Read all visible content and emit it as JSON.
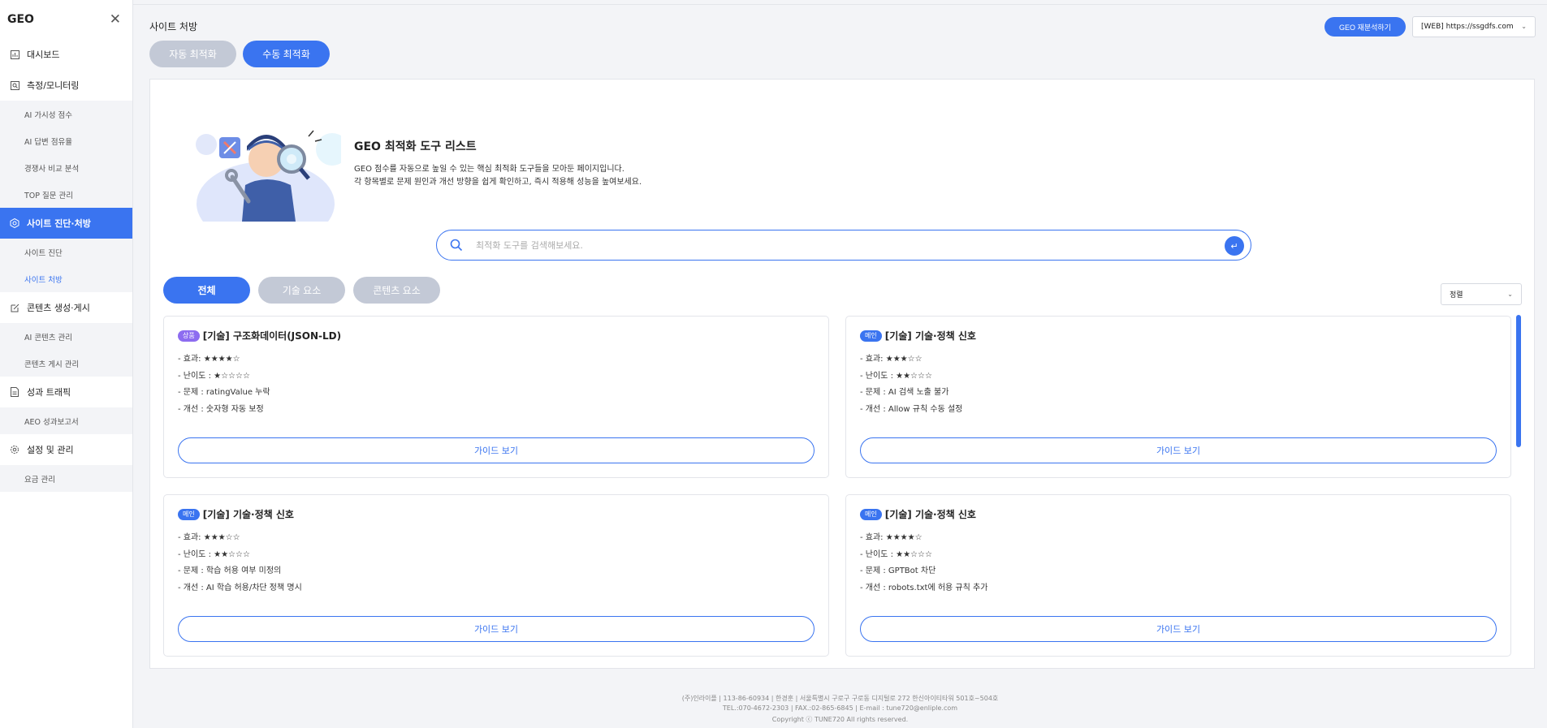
{
  "sidebar": {
    "logo": "GEO",
    "groups": [
      {
        "label": "대시보드",
        "icon": "chart-icon",
        "active": false,
        "subs": []
      },
      {
        "label": "측정/모니터링",
        "icon": "monitor-icon",
        "active": false,
        "subs": [
          {
            "label": "AI 가시성 점수",
            "active": false
          },
          {
            "label": "AI 답변 점유율",
            "active": false
          },
          {
            "label": "경쟁사 비교 분석",
            "active": false
          },
          {
            "label": "TOP 질문 관리",
            "active": false
          }
        ]
      },
      {
        "label": "사이트 진단·처방",
        "icon": "gear-hex-icon",
        "active": true,
        "subs": [
          {
            "label": "사이트 진단",
            "active": false
          },
          {
            "label": "사이트 처방",
            "active": true
          }
        ]
      },
      {
        "label": "콘텐츠 생성·게시",
        "icon": "edit-icon",
        "active": false,
        "subs": [
          {
            "label": "AI 콘텐츠 관리",
            "active": false
          },
          {
            "label": "콘텐츠 게시 관리",
            "active": false
          }
        ]
      },
      {
        "label": "성과 트래픽",
        "icon": "document-icon",
        "active": false,
        "subs": [
          {
            "label": "AEO 성과보고서",
            "active": false
          }
        ]
      },
      {
        "label": "설정 및 관리",
        "icon": "settings-icon",
        "active": false,
        "subs": [
          {
            "label": "요금 관리",
            "active": false
          }
        ]
      }
    ]
  },
  "header": {
    "title": "사이트 처방",
    "reanalyze_label": "GEO 재분석하기",
    "site_value": "[WEB] https://ssgdfs.com"
  },
  "mode_tabs": {
    "auto": "자동 최적화",
    "manual": "수동 최적화"
  },
  "hero": {
    "title": "GEO 최적화 도구 리스트",
    "desc1": "GEO 점수를 자동으로 높일 수 있는 핵심 최적화 도구들을 모아둔 페이지입니다.",
    "desc2": "각 항목별로 문제 원인과 개선 방향을 쉽게 확인하고, 즉시 적용해 성능을 높여보세요."
  },
  "search": {
    "placeholder": "최적화 도구를 검색해보세요."
  },
  "filters": [
    "전체",
    "기술 요소",
    "콘텐츠 요소"
  ],
  "sort": {
    "value": "정렬"
  },
  "cards": [
    {
      "badge": "상품",
      "badge_color": "#8d6cf0",
      "title": "[기술] 구조화데이터(JSON-LD)",
      "effect": "- 효과: ★★★★☆",
      "difficulty": "- 난이도 : ★☆☆☆☆",
      "problem": "- 문제 : ratingValue 누락",
      "improve": "- 개선 : 숫자형 자동 보정",
      "guide": "가이드 보기"
    },
    {
      "badge": "메인",
      "badge_color": "#3a74f0",
      "title": "[기술] 기술·정책 신호",
      "effect": "- 효과: ★★★☆☆",
      "difficulty": "- 난이도 : ★★☆☆☆",
      "problem": "- 문제 : AI 검색 노출 불가",
      "improve": "- 개선 : Allow 규칙 수동 설정",
      "guide": "가이드 보기"
    },
    {
      "badge": "메인",
      "badge_color": "#3a74f0",
      "title": "[기술] 기술·정책 신호",
      "effect": "- 효과: ★★★☆☆",
      "difficulty": "- 난이도 : ★★☆☆☆",
      "problem": "- 문제 : 학습 허용 여부 미정의",
      "improve": "- 개선 : AI 학습 허용/차단 정책 명시",
      "guide": "가이드 보기"
    },
    {
      "badge": "메인",
      "badge_color": "#3a74f0",
      "title": "[기술] 기술·정책 신호",
      "effect": "- 효과: ★★★★☆",
      "difficulty": "- 난이도 : ★★☆☆☆",
      "problem": "- 문제 : GPTBot 차단",
      "improve": "- 개선 : robots.txt에 허용 규칙 추가",
      "guide": "가이드 보기"
    }
  ],
  "footer": {
    "line1": "(주)인라이플  |  113-86-60934  |  한경훈  |  서울특별시 구로구 구로동 디지털로 272 한신아이티타워 501호~504호",
    "line2": "TEL.:070-4672-2303  |  FAX.:02-865-6845  |  E-mail : tune720@enliple.com",
    "line3": "Copyright ⓒ TUNE720 All rights reserved."
  },
  "colors": {
    "accent": "#3a74f0",
    "inactive": "#c3c9d6",
    "badge_product": "#8d6cf0"
  }
}
